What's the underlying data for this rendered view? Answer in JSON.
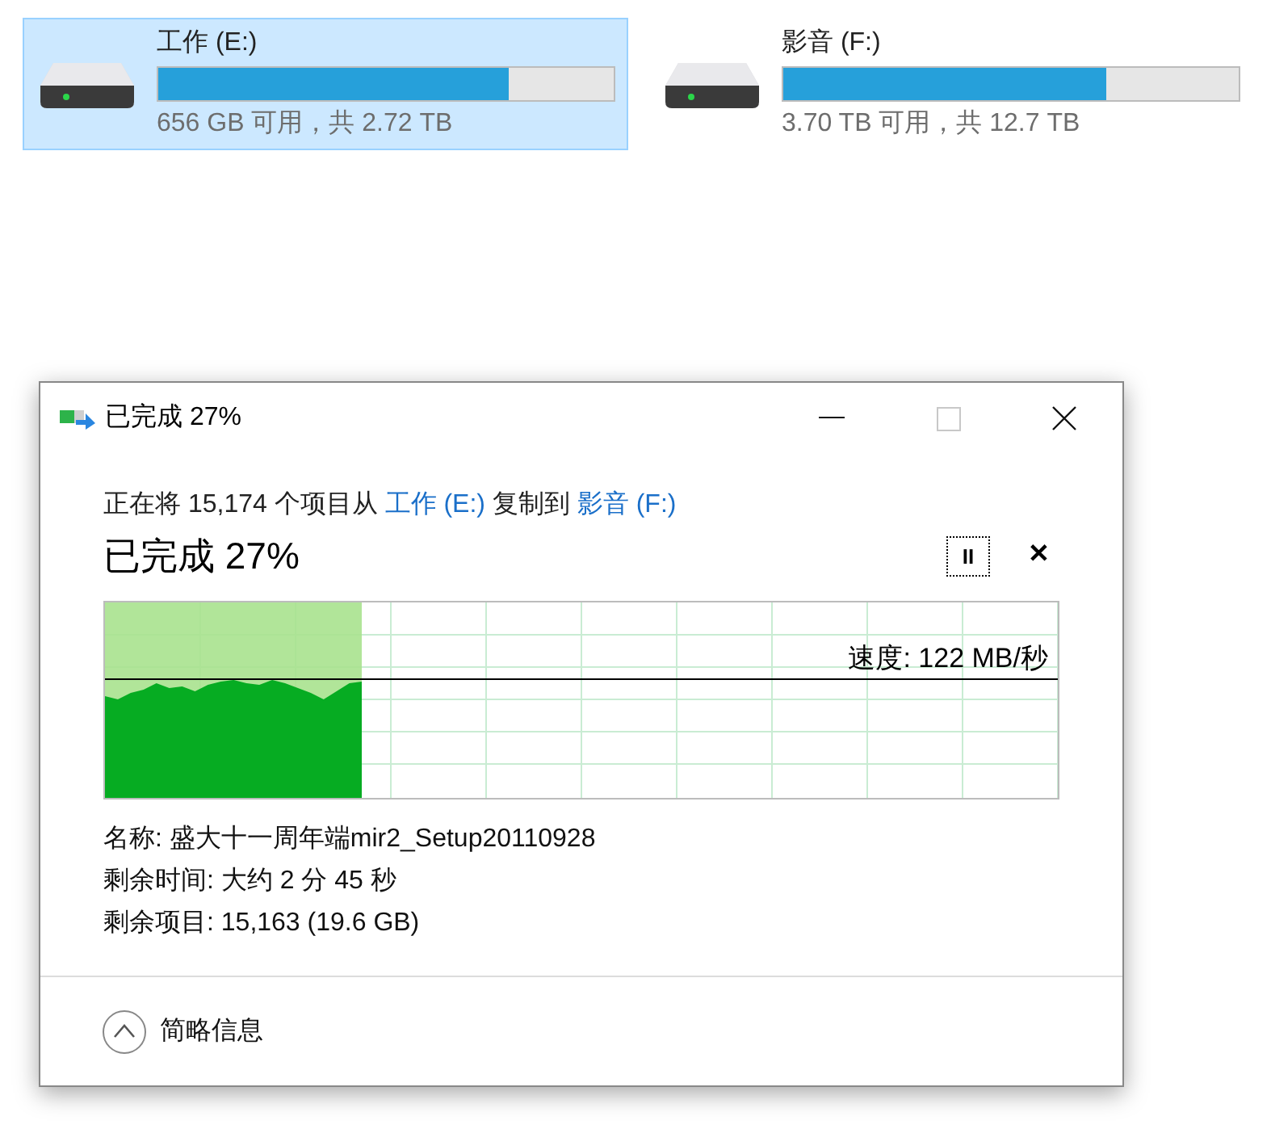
{
  "drives": [
    {
      "name": "工作 (E:)",
      "level": 0.77,
      "space": "656 GB 可用，共 2.72 TB",
      "selected": true
    },
    {
      "name": "影音 (F:)",
      "level": 0.71,
      "space": "3.70 TB 可用，共 12.7 TB",
      "selected": false
    }
  ],
  "dialog": {
    "title": "已完成 27%",
    "message": [
      {
        "kind": "text",
        "text": "正在将 15,174 个项目从 "
      },
      {
        "kind": "link",
        "text": "工作 (E:)"
      },
      {
        "kind": "text",
        "text": " 复制到 "
      },
      {
        "kind": "link",
        "text": "影音 (F:)"
      }
    ],
    "heading": "已完成 27%",
    "pause_button": "II",
    "cancel_button": "✕",
    "progress": {
      "level": 0.27,
      "speed": "速度: 122 MB/秒"
    },
    "details": [
      "名称: 盛大十一周年端mir2_Setup20110928",
      "剩余时间: 大约 2 分 45 秒",
      "剩余项目: 15,163 (19.6 GB)"
    ],
    "footer": "简略信息"
  }
}
